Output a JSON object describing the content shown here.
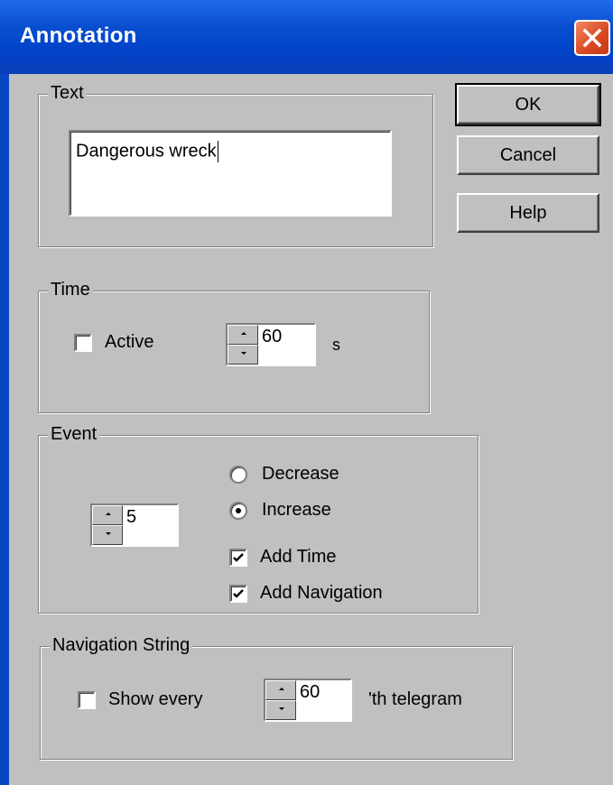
{
  "window": {
    "title": "Annotation"
  },
  "buttons": {
    "ok": "OK",
    "cancel": "Cancel",
    "help": "Help"
  },
  "text_group": {
    "label": "Text",
    "value": "Dangerous wreck"
  },
  "time_group": {
    "label": "Time",
    "active_label": "Active",
    "active_checked": false,
    "spin_value": "60",
    "unit": "s"
  },
  "event_group": {
    "label": "Event",
    "spin_value": "5",
    "decrease_label": "Decrease",
    "decrease_selected": false,
    "increase_label": "Increase",
    "increase_selected": true,
    "add_time_label": "Add Time",
    "add_time_checked": true,
    "add_nav_label": "Add Navigation",
    "add_nav_checked": true
  },
  "nav_group": {
    "label": "Navigation String",
    "show_every_label": "Show every",
    "show_every_checked": false,
    "spin_value": "60",
    "suffix": "'th telegram"
  },
  "colors": {
    "titlebar": "#0042c8",
    "close": "#d9461e",
    "face": "#c0c0c0"
  },
  "icons": {
    "close": "close-icon",
    "check": "check-icon",
    "spin_up": "arrow-up-icon",
    "spin_down": "arrow-down-icon"
  }
}
